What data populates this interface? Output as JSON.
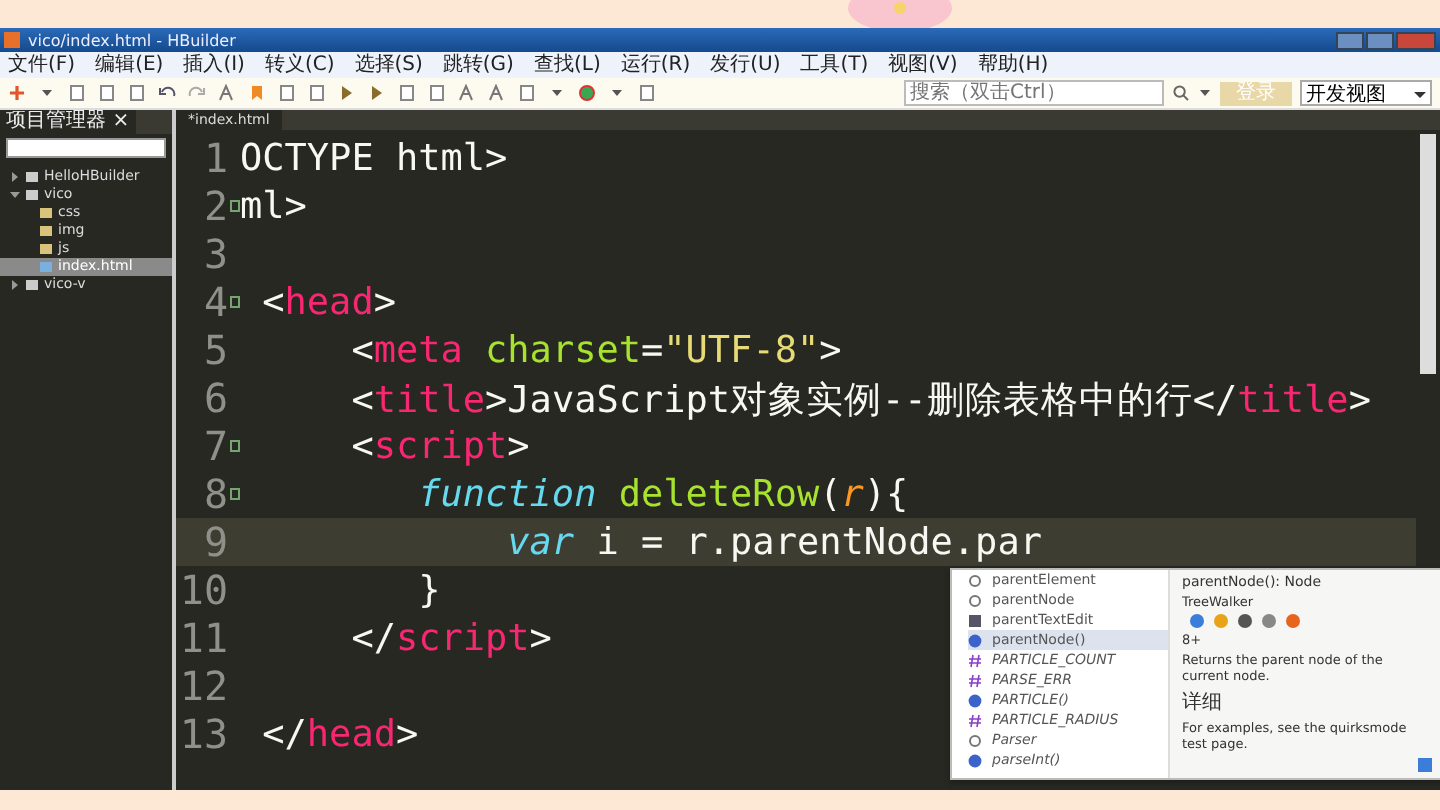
{
  "window": {
    "title": "vico/index.html - HBuilder"
  },
  "menu": [
    "文件(F)",
    "编辑(E)",
    "插入(I)",
    "转义(C)",
    "选择(S)",
    "跳转(G)",
    "查找(L)",
    "运行(R)",
    "发行(U)",
    "工具(T)",
    "视图(V)",
    "帮助(H)"
  ],
  "toolbar": {
    "search": {
      "placeholder": "搜索（双击Ctrl）"
    },
    "login_button": "登录",
    "view_select": "开发视图"
  },
  "sidebar": {
    "tab": "项目管理器",
    "close": "×",
    "tree": [
      {
        "label": "HelloHBuilder",
        "kind": "project",
        "selected": false,
        "expanded": false
      },
      {
        "label": "vico",
        "kind": "project",
        "selected": false,
        "expanded": true,
        "children": [
          {
            "label": "css",
            "kind": "folder",
            "selected": false
          },
          {
            "label": "img",
            "kind": "folder",
            "selected": false
          },
          {
            "label": "js",
            "kind": "folder",
            "selected": false
          },
          {
            "label": "index.html",
            "kind": "file",
            "selected": true
          }
        ]
      },
      {
        "label": "vico-v",
        "kind": "project",
        "selected": false,
        "expanded": false
      }
    ]
  },
  "editor": {
    "tab": "*index.html",
    "lines": [
      {
        "number": "1",
        "fold": false,
        "current": false,
        "tokens": [
          {
            "text": "OCTYPE html>",
            "kind": "text"
          }
        ]
      },
      {
        "number": "2",
        "fold": true,
        "current": false,
        "tokens": [
          {
            "text": "ml>",
            "kind": "text"
          }
        ]
      },
      {
        "number": "3",
        "fold": false,
        "current": false
      },
      {
        "number": "4",
        "fold": true,
        "current": false,
        "tokens": [
          {
            "text": " <",
            "kind": "text"
          },
          {
            "text": "head",
            "kind": "tag"
          },
          {
            "text": ">",
            "kind": "text"
          }
        ]
      },
      {
        "number": "5",
        "fold": false,
        "current": false,
        "tokens": [
          {
            "text": "     <",
            "kind": "text"
          },
          {
            "text": "meta",
            "kind": "tag"
          },
          {
            "text": " charset",
            "kind": "attr"
          },
          {
            "text": "=",
            "kind": "text"
          },
          {
            "text": "\"UTF-8\"",
            "kind": "string"
          },
          {
            "text": ">",
            "kind": "text"
          }
        ]
      },
      {
        "number": "6",
        "fold": false,
        "current": false,
        "tokens": [
          {
            "text": "     <",
            "kind": "text"
          },
          {
            "text": "title",
            "kind": "tag"
          },
          {
            "text": ">JavaScript对象实例--删除表格中的行</",
            "kind": "text"
          },
          {
            "text": "title",
            "kind": "tag"
          },
          {
            "text": ">",
            "kind": "text"
          }
        ]
      },
      {
        "number": "7",
        "fold": true,
        "current": false,
        "tokens": [
          {
            "text": "     <",
            "kind": "text"
          },
          {
            "text": "script",
            "kind": "tag"
          },
          {
            "text": ">",
            "kind": "text"
          }
        ]
      },
      {
        "number": "8",
        "fold": true,
        "current": false,
        "tokens": [
          {
            "text": "        function",
            "kind": "keyword"
          },
          {
            "text": " deleteRow",
            "kind": "func"
          },
          {
            "text": "(",
            "kind": "text"
          },
          {
            "text": "r",
            "kind": "param"
          },
          {
            "text": "){",
            "kind": "text"
          }
        ]
      },
      {
        "number": "9",
        "fold": false,
        "current": true,
        "tokens": [
          {
            "text": "            var",
            "kind": "keyword"
          },
          {
            "text": " i = r.parentNode.par",
            "kind": "text"
          }
        ]
      },
      {
        "number": "10",
        "fold": false,
        "current": false,
        "tokens": [
          {
            "text": "        }",
            "kind": "text"
          }
        ]
      },
      {
        "number": "11",
        "fold": false,
        "current": false,
        "tokens": [
          {
            "text": "     </",
            "kind": "text"
          },
          {
            "text": "script",
            "kind": "tag"
          },
          {
            "text": ">",
            "kind": "text"
          }
        ]
      },
      {
        "number": "12",
        "fold": false,
        "current": false
      },
      {
        "number": "13",
        "fold": false,
        "current": false,
        "tokens": [
          {
            "text": " </",
            "kind": "text"
          },
          {
            "text": "head",
            "kind": "tag"
          },
          {
            "text": ">",
            "kind": "text"
          }
        ]
      }
    ]
  },
  "autocomplete": {
    "items": [
      {
        "label": "parentElement",
        "kind": "property",
        "italic": false,
        "selected": false
      },
      {
        "label": "parentNode",
        "kind": "property",
        "italic": false,
        "selected": false
      },
      {
        "label": "parentTextEdit",
        "kind": "field",
        "italic": false,
        "selected": false
      },
      {
        "label": "parentNode()",
        "kind": "method",
        "italic": false,
        "selected": true
      },
      {
        "label": "PARTICLE_COUNT",
        "kind": "constant",
        "italic": true,
        "selected": false
      },
      {
        "label": "PARSE_ERR",
        "kind": "constant",
        "italic": true,
        "selected": false
      },
      {
        "label": "PARTICLE()",
        "kind": "method",
        "italic": true,
        "selected": false
      },
      {
        "label": "PARTICLE_RADIUS",
        "kind": "constant",
        "italic": true,
        "selected": false
      },
      {
        "label": "Parser",
        "kind": "property",
        "italic": true,
        "selected": false
      },
      {
        "label": "parseInt()",
        "kind": "method",
        "italic": true,
        "selected": false
      }
    ],
    "doc": {
      "signature": "parentNode(): Node",
      "owner": "TreeWalker",
      "version": "8+",
      "description": "Returns the parent node of the current node.",
      "detail_link": "详细",
      "note": "For examples, see the quirksmode test page."
    }
  }
}
